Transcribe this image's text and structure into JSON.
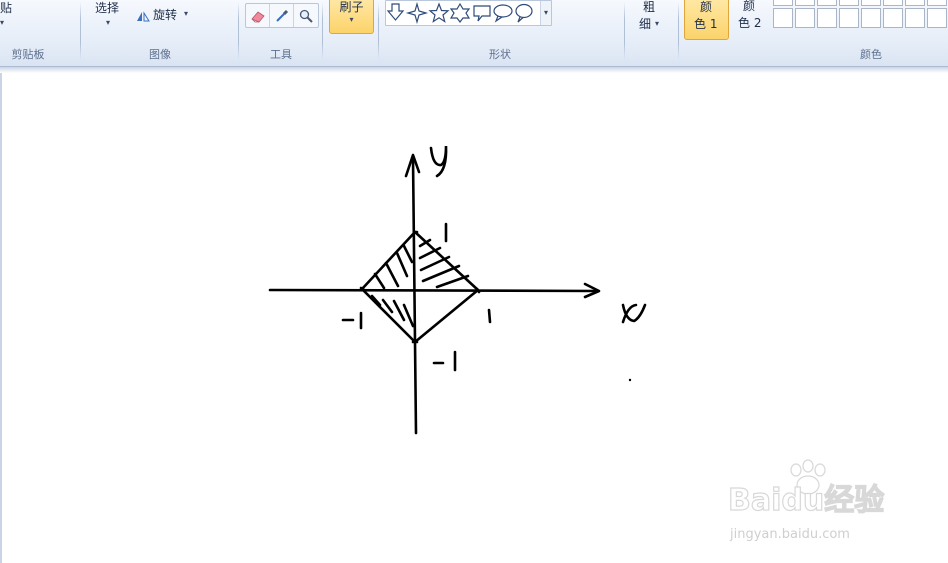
{
  "ribbon": {
    "clipboard": {
      "paste_label": "贴",
      "group_label": "剪贴板"
    },
    "image": {
      "select_label": "选择",
      "rotate_label": "旋转",
      "group_label": "图像"
    },
    "tools": {
      "group_label": "工具",
      "items": [
        "eraser-icon",
        "color-picker-icon",
        "magnifier-icon"
      ]
    },
    "brush": {
      "label": "刷子"
    },
    "shapes": {
      "group_label": "形状"
    },
    "size": {
      "label_line1": "粗",
      "label_line2": "细"
    },
    "colors": {
      "color1_line1": "颜",
      "color1_line2": "色 1",
      "color2_line1": "颜",
      "color2_line2": "色 2",
      "group_label": "颜色",
      "active_highlight": "#fcd36a"
    }
  },
  "canvas": {
    "sketch": {
      "y_axis_label": "y",
      "x_axis_label": "x",
      "label_top": "1",
      "label_left": "-1",
      "label_right": "1",
      "label_bottom": "-1"
    }
  },
  "watermark": {
    "brand": "Baidu经验",
    "url": "jingyan.baidu.com"
  }
}
